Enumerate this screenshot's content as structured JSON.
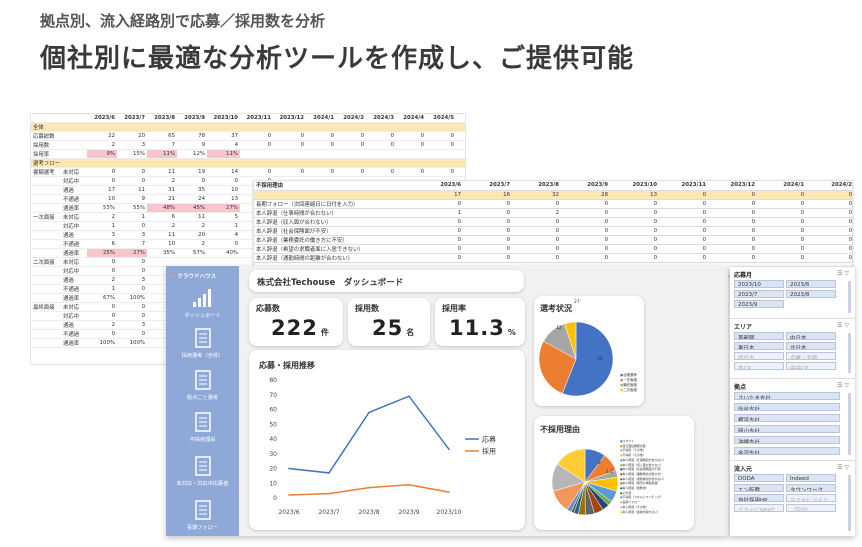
{
  "header": {
    "subtitle": "拠点別、流入経路別で応募／採用数を分析",
    "title": "個社別に最適な分析ツールを作成し、ご提供可能"
  },
  "sheet1": {
    "columns": [
      "",
      "",
      "2023/6",
      "2023/7",
      "2023/8",
      "2023/9",
      "2023/10",
      "2023/11",
      "2023/12",
      "2024/1",
      "2024/2",
      "2024/3",
      "2024/4",
      "2024/5",
      "合計"
    ],
    "rows": [
      {
        "s": "h",
        "c": [
          "全体",
          "",
          "",
          "",
          "",
          "",
          "",
          "",
          "",
          "",
          "",
          "",
          "",
          "",
          ""
        ]
      },
      {
        "c": [
          "応募総数",
          "",
          "22",
          "20",
          "65",
          "78",
          "37",
          "0",
          "0",
          "0",
          "0",
          "0",
          "0",
          "0",
          "222"
        ]
      },
      {
        "c": [
          "採用数",
          "",
          "2",
          "3",
          "7",
          "9",
          "4",
          "0",
          "0",
          "0",
          "0",
          "0",
          "0",
          "0",
          "25"
        ]
      },
      {
        "c": [
          "採用率",
          "",
          "9%",
          "15%",
          "11%",
          "12%",
          "11%",
          "",
          "",
          "",
          "",
          "",
          "",
          "",
          "11.3%"
        ],
        "pink": [
          2,
          4,
          6
        ]
      },
      {
        "s": "h",
        "c": [
          "選考フロー",
          "",
          "",
          "",
          "",
          "",
          "",
          "",
          "",
          "",
          "",
          "",
          "",
          "",
          ""
        ]
      },
      {
        "c": [
          "書類選考",
          "未対応",
          "0",
          "0",
          "11",
          "19",
          "14",
          "0",
          "0",
          "0",
          "0",
          "0",
          "0",
          "0",
          "44"
        ]
      },
      {
        "c": [
          "",
          "対応中",
          "0",
          "0",
          "2",
          "0",
          "0",
          "0",
          "",
          "",
          "",
          "",
          "",
          "",
          ""
        ]
      },
      {
        "c": [
          "",
          "通過",
          "17",
          "11",
          "31",
          "35",
          "10",
          "0",
          "",
          "",
          "",
          "",
          "",
          "",
          ""
        ]
      },
      {
        "c": [
          "",
          "不通過",
          "10",
          "9",
          "21",
          "24",
          "13",
          "0",
          "",
          "",
          "",
          "",
          "",
          "",
          ""
        ]
      },
      {
        "c": [
          "",
          "通過率",
          "55%",
          "55%",
          "48%",
          "45%",
          "27%",
          "0%",
          "",
          "",
          "",
          "",
          "",
          "",
          ""
        ],
        "pink": [
          4,
          5,
          6
        ]
      },
      {
        "c": [
          "一次面接",
          "未対応",
          "2",
          "1",
          "6",
          "11",
          "5",
          "0",
          "",
          "",
          "",
          "",
          "",
          "",
          ""
        ]
      },
      {
        "c": [
          "",
          "対応中",
          "1",
          "0",
          "2",
          "2",
          "1",
          "0",
          "",
          "",
          "",
          "",
          "",
          "",
          ""
        ]
      },
      {
        "c": [
          "",
          "通過",
          "3",
          "3",
          "11",
          "20",
          "4",
          "0",
          "",
          "",
          "",
          "",
          "",
          "",
          ""
        ]
      },
      {
        "c": [
          "",
          "不通過",
          "6",
          "7",
          "10",
          "2",
          "0",
          "0",
          "",
          "",
          "",
          "",
          "",
          "",
          ""
        ]
      },
      {
        "c": [
          "",
          "通過率",
          "25%",
          "27%",
          "35%",
          "57%",
          "40%",
          "0%",
          "",
          "",
          "",
          "",
          "",
          "",
          ""
        ],
        "pink": [
          2,
          3
        ]
      },
      {
        "c": [
          "二次面接",
          "未対応",
          "0",
          "0",
          "",
          "",
          "",
          "",
          "",
          "",
          "",
          "",
          "",
          "",
          ""
        ]
      },
      {
        "c": [
          "",
          "対応中",
          "0",
          "0",
          "",
          "",
          "",
          "",
          "",
          "",
          "",
          "",
          "",
          "",
          ""
        ]
      },
      {
        "c": [
          "",
          "通過",
          "2",
          "3",
          "",
          "",
          "",
          "",
          "",
          "",
          "",
          "",
          "",
          "",
          ""
        ]
      },
      {
        "c": [
          "",
          "不通過",
          "1",
          "0",
          "",
          "",
          "",
          "",
          "",
          "",
          "",
          "",
          "",
          "",
          ""
        ]
      },
      {
        "c": [
          "",
          "通過率",
          "67%",
          "100%",
          "",
          "",
          "",
          "",
          "",
          "",
          "",
          "",
          "",
          "",
          ""
        ]
      },
      {
        "c": [
          "最終面接",
          "未対応",
          "0",
          "0",
          "",
          "",
          "",
          "",
          "",
          "",
          "",
          "",
          "",
          "",
          ""
        ]
      },
      {
        "c": [
          "",
          "対応中",
          "0",
          "0",
          "",
          "",
          "",
          "",
          "",
          "",
          "",
          "",
          "",
          "",
          ""
        ]
      },
      {
        "c": [
          "",
          "通過",
          "2",
          "3",
          "",
          "",
          "",
          "",
          "",
          "",
          "",
          "",
          "",
          "",
          ""
        ]
      },
      {
        "c": [
          "",
          "不通過",
          "0",
          "0",
          "",
          "",
          "",
          "",
          "",
          "",
          "",
          "",
          "",
          "",
          ""
        ]
      },
      {
        "c": [
          "",
          "通過率",
          "100%",
          "100%",
          "",
          "",
          "",
          "",
          "",
          "",
          "",
          "",
          "",
          "",
          ""
        ]
      }
    ]
  },
  "sheet2": {
    "columns": [
      "不採用理由",
      "2023/6",
      "2023/7",
      "2023/8",
      "2023/9",
      "2023/10",
      "2023/11",
      "2023/12",
      "2024/1",
      "2024/2"
    ],
    "rows": [
      {
        "sum": true,
        "c": [
          "",
          "17",
          "16",
          "32",
          "28",
          "13",
          "0",
          "0",
          "0",
          "0"
        ]
      },
      {
        "c": [
          "長期フォロー（次回連絡日に日付を入力）",
          "0",
          "0",
          "0",
          "0",
          "0",
          "0",
          "0",
          "0",
          "0"
        ]
      },
      {
        "c": [
          "本人辞退（仕事時間が合わない）",
          "1",
          "0",
          "2",
          "0",
          "0",
          "0",
          "0",
          "0",
          "0"
        ]
      },
      {
        "c": [
          "本人辞退（収入面が合わない）",
          "0",
          "0",
          "0",
          "0",
          "0",
          "0",
          "0",
          "0",
          "0"
        ]
      },
      {
        "c": [
          "本人辞退（社会保険面が不安）",
          "0",
          "0",
          "0",
          "0",
          "0",
          "0",
          "0",
          "0",
          "0"
        ]
      },
      {
        "c": [
          "本人辞退（業務委託の働き方に不安）",
          "0",
          "0",
          "0",
          "0",
          "0",
          "0",
          "0",
          "0",
          "0"
        ]
      },
      {
        "c": [
          "本人辞退（希望の求職者面に入居できない）",
          "0",
          "0",
          "0",
          "0",
          "0",
          "0",
          "0",
          "0",
          "0"
        ]
      },
      {
        "c": [
          "本人辞退（通勤時間の距離が合わない）",
          "0",
          "0",
          "0",
          "0",
          "0",
          "0",
          "0",
          "0",
          "0"
        ]
      }
    ]
  },
  "dashboard": {
    "logo": "クラウドハウス",
    "title": "株式会社Techouse　ダッシュボード",
    "nav": [
      "ダッシュボード",
      "採用選考（全体）",
      "拠点ごと選考",
      "不採用理由",
      "未対応・対応中応募者",
      "長期フォロー"
    ],
    "kpis": [
      {
        "label": "応募数",
        "value": "222",
        "unit": "件"
      },
      {
        "label": "採用数",
        "value": "25",
        "unit": "名"
      },
      {
        "label": "採用率",
        "value": "11.3",
        "unit": "%"
      }
    ],
    "line_title": "応募・採用推移",
    "pie1_title": "選考状況",
    "pie1_legend": [
      "合格選考",
      "一次面接",
      "最終面接",
      "二次面接"
    ],
    "pie1_labels": [
      "12",
      "27",
      "56"
    ],
    "pie2_title": "不採用理由",
    "pie2_labels": [
      "2",
      "1.2"
    ],
    "pie2_legend": [
      "スカウト",
      "当日面接無断欠席",
      "不採用（その他）",
      "不採用（その他）",
      "本人辞退（仕事時間が合わない）",
      "本人辞退（収入面が合わない）",
      "本人辞退（社会保険面が不安）",
      "本人辞退（業務委託の働き方）",
      "本人辞退（通勤時間が合わない）",
      "本人辞退（希望の求職者面）",
      "本人辞退（勤務地）",
      "その他",
      "不採用（スキルとマッチング）",
      "長期フォロー",
      "本人辞退（その他）",
      "本人辞退（連絡が取れない）"
    ]
  },
  "filters": {
    "groups": [
      {
        "title": "応募月",
        "opts": [
          "2023/10",
          "2023/6",
          "2023/7",
          "2023/8",
          "2023/9"
        ],
        "dim": []
      },
      {
        "title": "エリア",
        "opts": [
          "首都圏",
          "中日本",
          "東日本",
          "北日本",
          "西日本",
          "近畿・北陸",
          "本CP",
          "中央CP"
        ],
        "dim": [
          4,
          5,
          6,
          7
        ]
      },
      {
        "title": "拠点",
        "opts": [
          "さいたま支社",
          "仙台支社",
          "横浜支社",
          "岡山支社",
          "沖縄支社",
          "金沢支社"
        ],
        "dim": []
      },
      {
        "title": "流入元",
        "opts": [
          "DODA",
          "Indeed",
          "エン転職",
          "タウンワーク",
          "自社採用HP",
          "マイナビバイト",
          "ミクナビNEXT",
          "（空白）"
        ],
        "dim": [
          5,
          6,
          7
        ]
      }
    ]
  },
  "chart_data": [
    {
      "type": "line",
      "title": "応募・採用推移",
      "categories": [
        "2023/6",
        "2023/7",
        "2023/8",
        "2023/9",
        "2023/10"
      ],
      "series": [
        {
          "name": "応募",
          "values": [
            20,
            17,
            58,
            69,
            33
          ]
        },
        {
          "name": "採用",
          "values": [
            2,
            3,
            7,
            9,
            4
          ]
        }
      ],
      "ylim": [
        0,
        80
      ],
      "yticks": [
        0,
        10,
        20,
        30,
        40,
        50,
        60,
        70,
        80
      ],
      "grid": false,
      "legend": "right",
      "colors": [
        "#4472c4",
        "#ed7d31"
      ]
    },
    {
      "type": "pie",
      "title": "選考状況",
      "values": [
        56,
        27,
        12,
        5
      ],
      "colors": [
        "#4472c4",
        "#ed7d31",
        "#a5a5a5",
        "#ffc000"
      ]
    },
    {
      "type": "pie",
      "title": "不採用理由",
      "values": [
        9,
        8,
        3,
        6,
        5,
        2,
        3,
        4,
        4,
        3,
        2,
        1.2,
        2,
        10,
        12,
        14
      ],
      "colors": [
        "#4472c4",
        "#ed7d31",
        "#a5a5a5",
        "#ffc000",
        "#5b9bd5",
        "#70ad47",
        "#264478",
        "#9e480e",
        "#636363",
        "#997300",
        "#255e91",
        "#43682b",
        "#698ed0",
        "#f1975a",
        "#b7b7b7",
        "#ffcd33"
      ]
    }
  ]
}
